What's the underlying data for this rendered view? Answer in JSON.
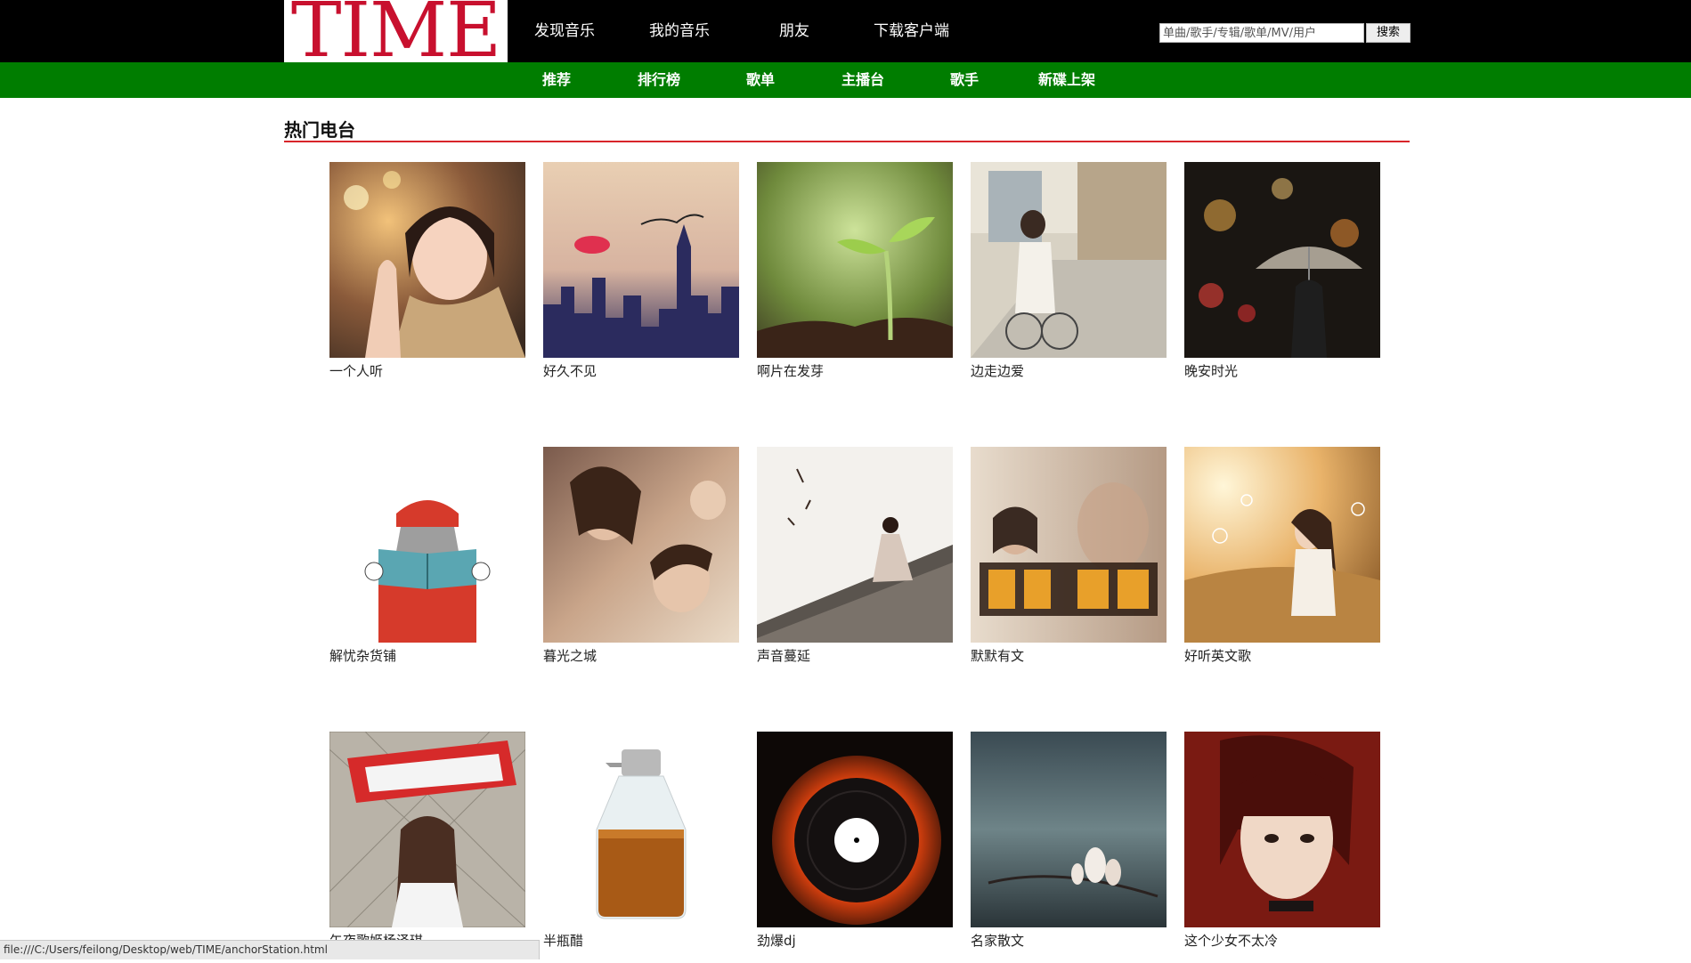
{
  "header": {
    "logo_text": "TIME",
    "nav": [
      {
        "label": "发现音乐"
      },
      {
        "label": "我的音乐"
      },
      {
        "label": "朋友"
      },
      {
        "label": "下载客户端"
      }
    ],
    "search": {
      "placeholder": "单曲/歌手/专辑/歌单/MV/用户",
      "button_label": "搜索"
    }
  },
  "subnav": [
    {
      "label": "推荐"
    },
    {
      "label": "排行榜"
    },
    {
      "label": "歌单"
    },
    {
      "label": "主播台"
    },
    {
      "label": "歌手"
    },
    {
      "label": "新碟上架"
    }
  ],
  "section": {
    "title": "热门电台"
  },
  "stations": [
    {
      "label": "一个人听",
      "icon": "girl-praying-photo"
    },
    {
      "label": "好久不见",
      "icon": "city-skyline-kiss-photo"
    },
    {
      "label": "啊片在发芽",
      "icon": "sprout-photo"
    },
    {
      "label": "边走边爱",
      "icon": "girl-bicycle-street-photo"
    },
    {
      "label": "晚安时光",
      "icon": "umbrella-night-photo"
    },
    {
      "label": "解忧杂货铺",
      "icon": "girl-reading-illustration"
    },
    {
      "label": "暮光之城",
      "icon": "couple-photo"
    },
    {
      "label": "声音蔓延",
      "icon": "girl-on-wall-photo"
    },
    {
      "label": "默默有文",
      "icon": "text-poster-photo"
    },
    {
      "label": "好听英文歌",
      "icon": "girl-bubbles-field-photo"
    },
    {
      "label": "午夜歌姬杨泽琪",
      "icon": "girl-holding-scarf-photo"
    },
    {
      "label": "半瓶醋",
      "icon": "vinegar-bottle-photo"
    },
    {
      "label": "劲爆dj",
      "icon": "burning-vinyl-record-photo"
    },
    {
      "label": "名家散文",
      "icon": "magnolia-branch-photo"
    },
    {
      "label": "这个少女不太冷",
      "icon": "girl-bob-haircut-illustration"
    }
  ],
  "status_bar": {
    "url": "file:///C:/Users/feilong/Desktop/web/TIME/anchorStation.html"
  },
  "colors": {
    "topbar": "#000000",
    "subbar": "#007d00",
    "accent": "#d8252a",
    "logo": "#c8102e"
  }
}
